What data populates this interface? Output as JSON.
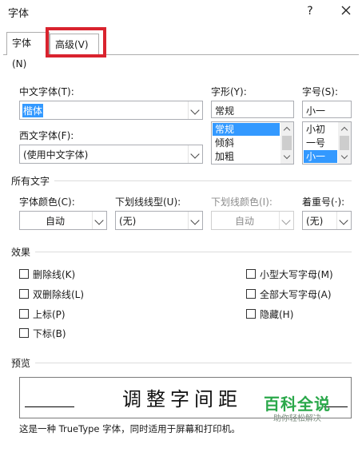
{
  "window": {
    "title": "字体",
    "help_label": "?"
  },
  "tabs": {
    "font": {
      "label": "字体(N)",
      "active": true
    },
    "advanced": {
      "label": "高级(V)",
      "highlight_color": "#d9232e"
    }
  },
  "chinese_font": {
    "label": "中文字体(T):",
    "value": "楷体"
  },
  "western_font": {
    "label": "西文字体(F):",
    "value": "(使用中文字体)"
  },
  "style": {
    "label": "字形(Y):",
    "value": "常规",
    "options": [
      "常规",
      "倾斜",
      "加粗"
    ],
    "selected_index": 0
  },
  "size": {
    "label": "字号(S):",
    "value": "小一",
    "options": [
      "小初",
      "一号",
      "小一"
    ],
    "selected_index": 2
  },
  "all_text": {
    "section_label": "所有文字",
    "font_color": {
      "label": "字体颜色(C):",
      "value": "自动"
    },
    "underline_style": {
      "label": "下划线线型(U):",
      "value": "(无)"
    },
    "underline_color": {
      "label": "下划线颜色(I):",
      "value": "自动",
      "disabled": true
    },
    "emphasis": {
      "label": "着重号(·):",
      "value": "(无)"
    }
  },
  "effects": {
    "section_label": "效果",
    "left": [
      {
        "label": "删除线(K)",
        "checked": false
      },
      {
        "label": "双删除线(L)",
        "checked": false
      },
      {
        "label": "上标(P)",
        "checked": false
      },
      {
        "label": "下标(B)",
        "checked": false
      }
    ],
    "right": [
      {
        "label": "小型大写字母(M)",
        "checked": false
      },
      {
        "label": "全部大写字母(A)",
        "checked": false
      },
      {
        "label": "隐藏(H)",
        "checked": false
      }
    ]
  },
  "preview": {
    "section_label": "预览",
    "sample_text": "调整字间距",
    "note": "这是一种 TrueType 字体，同时适用于屏幕和打印机。"
  },
  "watermark": {
    "main": "百科全说",
    "sub": "助你轻松解决",
    "color": "#2aa84a"
  },
  "colors": {
    "selection": "#3399ff",
    "border": "#abadb3"
  }
}
